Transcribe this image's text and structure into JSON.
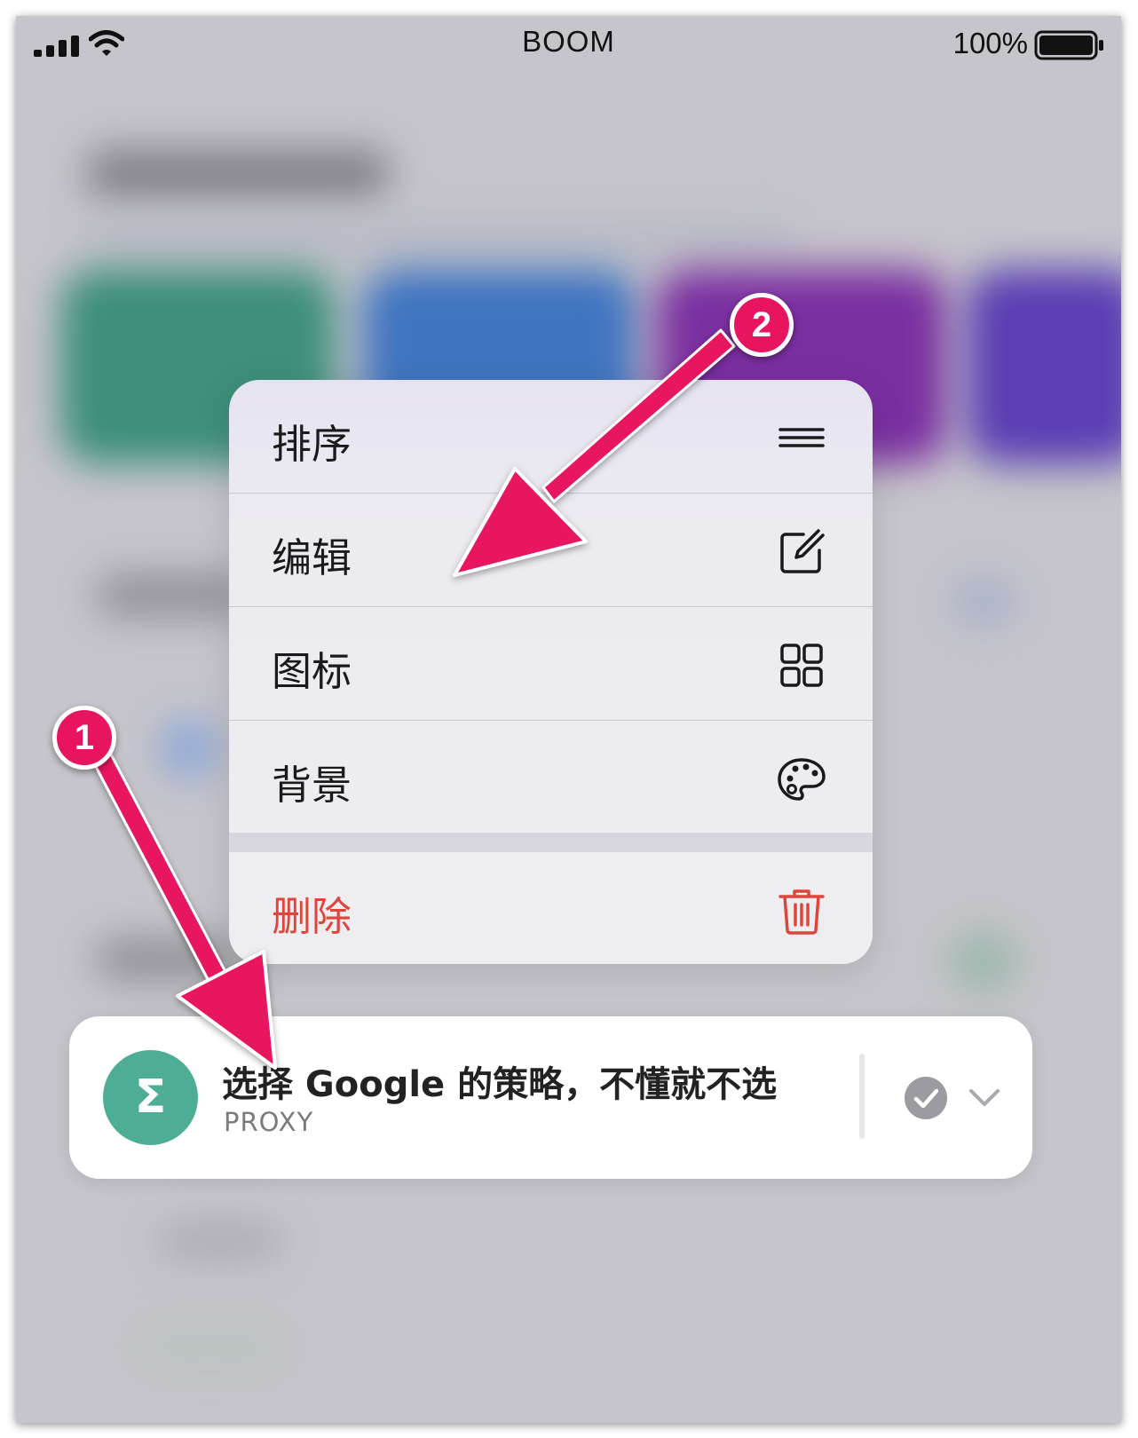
{
  "status_bar": {
    "carrier": "BOOM",
    "battery_percent": "100%",
    "signal_icon": "cellular-signal-icon",
    "wifi_icon": "wifi-icon",
    "battery_icon": "battery-icon",
    "battery_level": 1.0
  },
  "context_menu": {
    "items": [
      {
        "label": "排序",
        "icon": "reorder-lines-icon"
      },
      {
        "label": "编辑",
        "icon": "edit-square-pencil-icon"
      },
      {
        "label": "图标",
        "icon": "grid-icon"
      },
      {
        "label": "背景",
        "icon": "palette-icon"
      }
    ],
    "delete": {
      "label": "删除",
      "icon": "trash-icon",
      "color": "#e0453b"
    }
  },
  "policy_card": {
    "avatar_glyph": "Σ",
    "avatar_color": "#4eae95",
    "title": "选择 Google 的策略，不懂就不选",
    "subtitle": "PROXY",
    "check_icon": "checkmark-circle-icon",
    "chevron_icon": "chevron-down-icon"
  },
  "annotations": {
    "badge_1": "1",
    "badge_2": "2",
    "color": "#e8145f"
  }
}
